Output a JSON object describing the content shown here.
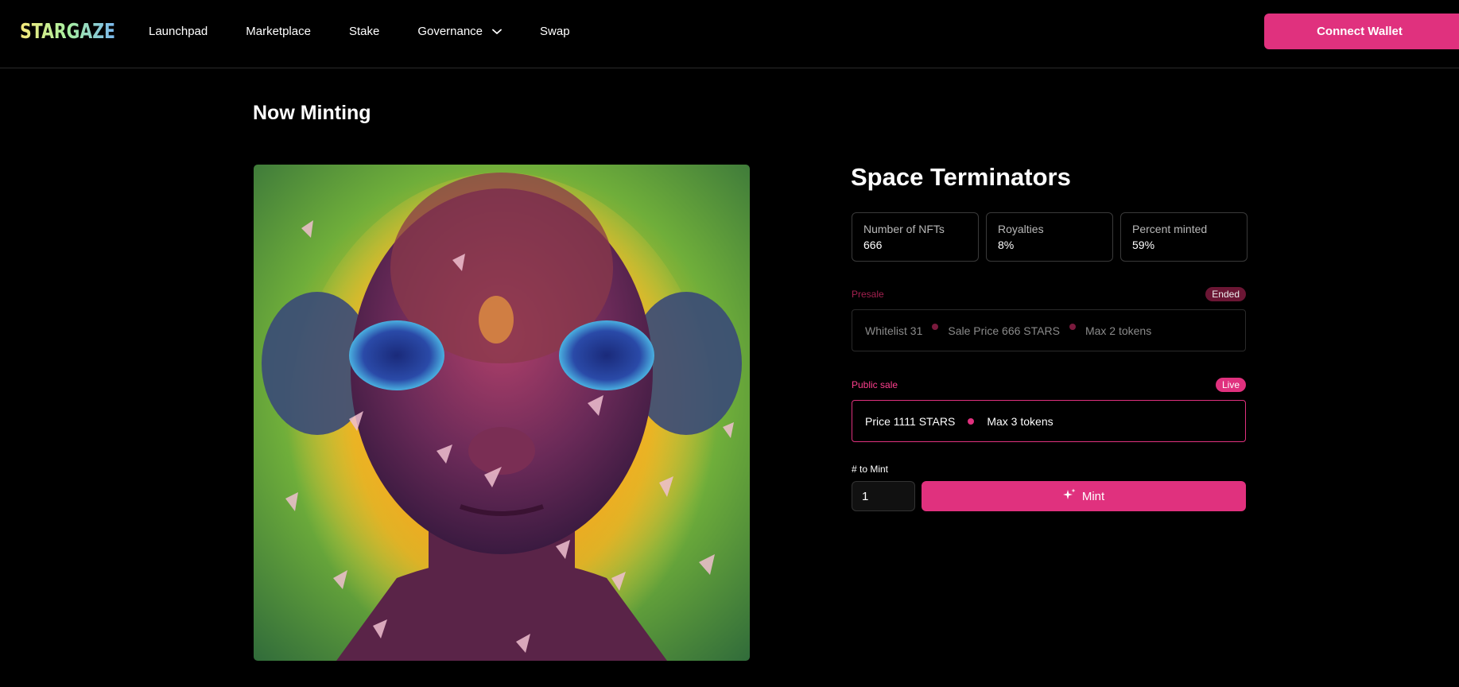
{
  "header": {
    "logo_text": "STARGAZE",
    "nav": [
      {
        "label": "Launchpad",
        "icon": null
      },
      {
        "label": "Marketplace",
        "icon": null
      },
      {
        "label": "Stake",
        "icon": null
      },
      {
        "label": "Governance",
        "icon": "chevron-down-icon"
      },
      {
        "label": "Swap",
        "icon": null
      }
    ],
    "connect_label": "Connect Wallet"
  },
  "page": {
    "title": "Now Minting"
  },
  "collection": {
    "name": "Space Terminators",
    "stats": [
      {
        "label": "Number of NFTs",
        "value": "666"
      },
      {
        "label": "Royalties",
        "value": "8%"
      },
      {
        "label": "Percent minted",
        "value": "59%"
      }
    ],
    "presale": {
      "label": "Presale",
      "status": "Ended",
      "items": [
        "Whitelist 31",
        "Sale Price 666 STARS",
        "Max 2 tokens"
      ]
    },
    "public_sale": {
      "label": "Public sale",
      "status": "Live",
      "items": [
        "Price 1111 STARS",
        "Max 3 tokens"
      ]
    },
    "mint": {
      "quantity_label": "# to Mint",
      "quantity_value": "1",
      "button_label": "Mint",
      "button_icon": "sparkles-icon"
    }
  },
  "colors": {
    "accent": "#e0317e",
    "background": "#000000",
    "ended_badge": "#6b1634"
  }
}
